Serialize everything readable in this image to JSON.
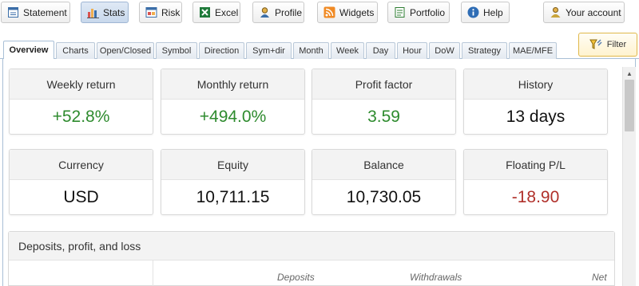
{
  "toolbar": {
    "buttons": [
      {
        "label": "Statement",
        "icon": "statement-icon"
      },
      {
        "label": "Stats",
        "icon": "bar-chart-icon",
        "active": true
      },
      {
        "label": "Risk",
        "icon": "risk-icon"
      },
      {
        "label": "Excel",
        "icon": "excel-icon"
      },
      {
        "label": "Profile",
        "icon": "profile-icon"
      },
      {
        "label": "Widgets",
        "icon": "rss-icon"
      },
      {
        "label": "Portfolio",
        "icon": "portfolio-icon"
      },
      {
        "label": "Help",
        "icon": "info-icon"
      },
      {
        "label": "Your account",
        "icon": "account-icon"
      }
    ]
  },
  "tabs": [
    "Overview",
    "Charts",
    "Open/Closed",
    "Symbol",
    "Direction",
    "Sym+dir",
    "Month",
    "Week",
    "Day",
    "Hour",
    "DoW",
    "Strategy",
    "MAE/MFE"
  ],
  "active_tab": "Overview",
  "filter": {
    "label": "Filter"
  },
  "cards": [
    {
      "label": "Weekly return",
      "value": "+52.8%",
      "tone": "pos"
    },
    {
      "label": "Monthly return",
      "value": "+494.0%",
      "tone": "pos"
    },
    {
      "label": "Profit factor",
      "value": "3.59",
      "tone": "pos"
    },
    {
      "label": "History",
      "value": "13 days",
      "tone": "neutral"
    },
    {
      "label": "Currency",
      "value": "USD",
      "tone": "neutral"
    },
    {
      "label": "Equity",
      "value": "10,711.15",
      "tone": "neutral"
    },
    {
      "label": "Balance",
      "value": "10,730.05",
      "tone": "neutral"
    },
    {
      "label": "Floating P/L",
      "value": "-18.90",
      "tone": "neg"
    }
  ],
  "deposits_panel": {
    "title": "Deposits, profit, and loss",
    "columns": [
      "Deposits",
      "Withdrawals",
      "Net"
    ]
  },
  "colors": {
    "positive": "#2e8b2e",
    "negative": "#b0302a",
    "tab_border": "#a9bfd6",
    "filter_border": "#e0b84a"
  }
}
